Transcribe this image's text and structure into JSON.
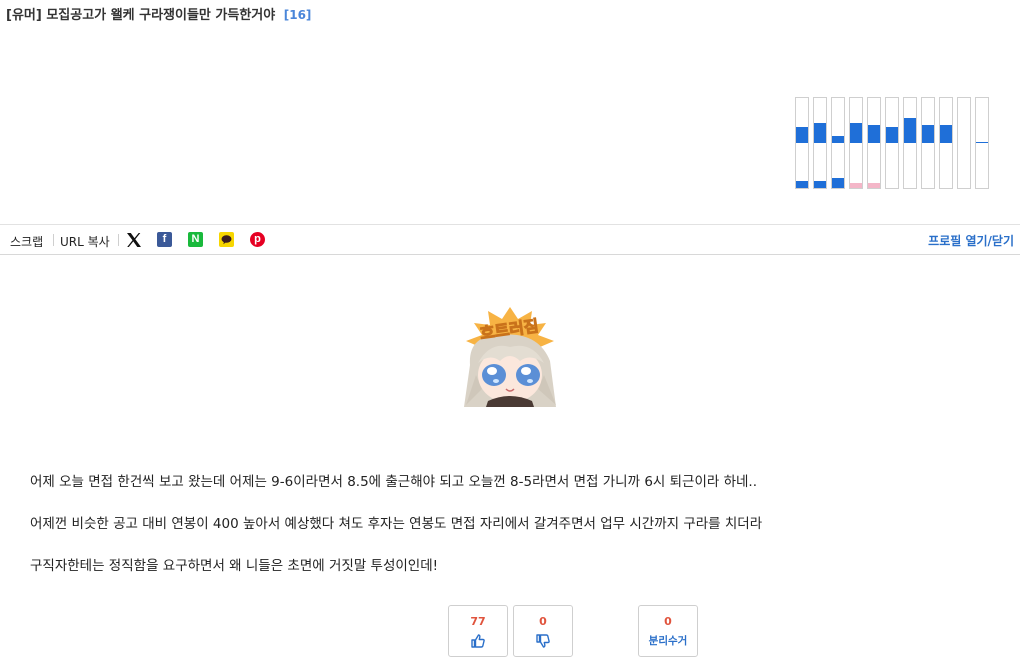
{
  "post": {
    "category": "[유머]",
    "title": "모집공고가 왤케 구라쟁이들만 가득한거야",
    "comment_count": "[16]"
  },
  "vote_history": {
    "up_fractions": [
      0.35,
      0.45,
      0.15,
      0.45,
      0.4,
      0.35,
      0.55,
      0.4,
      0.4,
      0.0,
      0.02
    ],
    "down_fractions": [
      0.15,
      0.15,
      0.22,
      0.1,
      0.1,
      0.0,
      0.0,
      0.0,
      0.0,
      0.0,
      0.0
    ],
    "down_colors": [
      "#1f6fd8",
      "#1f6fd8",
      "#1f6fd8",
      "#f4b6c8",
      "#f4b6c8",
      "#1f6fd8",
      "#1f6fd8",
      "#1f6fd8",
      "#1f6fd8",
      "#1f6fd8",
      "#1f6fd8"
    ],
    "up_color": "#1f6fd8"
  },
  "toolbar": {
    "scrap_label": "스크랩",
    "url_copy_label": "URL 복사",
    "share_icons": [
      "x-icon",
      "facebook-icon",
      "naver-icon",
      "kakaotalk-icon",
      "pinterest-icon"
    ],
    "profile_toggle": "프로필 열기/닫기"
  },
  "content": {
    "sticker_text": "흐트러짐",
    "paragraphs": [
      "어제 오늘 면접 한건씩 보고 왔는데 어제는 9-6이라면서 8.5에 출근해야 되고 오늘껀 8-5라면서 면접 가니까 6시 퇴근이라 하네..",
      "어제껀 비슷한 공고 대비 연봉이 400 높아서 예상했다 쳐도 후자는 연봉도 면접 자리에서 갈겨주면서 업무 시간까지 구라를 치더라",
      "구직자한테는 정직함을 요구하면서 왜 니들은 초면에 거짓말 투성이인데!"
    ]
  },
  "votes": {
    "upvote_count": "77",
    "downvote_count": "0",
    "recycle_count": "0",
    "recycle_label": "분리수거"
  },
  "colors": {
    "accent_blue": "#2a6fc9",
    "vote_red": "#e0533c"
  }
}
